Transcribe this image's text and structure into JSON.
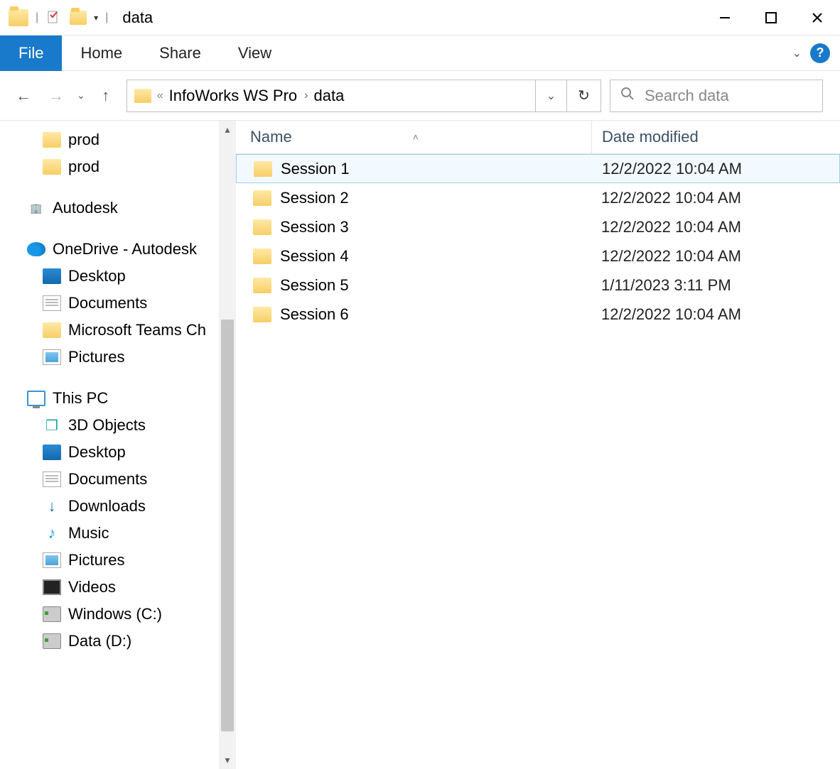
{
  "window": {
    "title": "data"
  },
  "ribbon": {
    "file": "File",
    "home": "Home",
    "share": "Share",
    "view": "View"
  },
  "address": {
    "overflow": "«",
    "segments": [
      "InfoWorks WS Pro",
      "data"
    ]
  },
  "search": {
    "placeholder": "Search data"
  },
  "columns": {
    "name": "Name",
    "date": "Date modified"
  },
  "files": [
    {
      "name": "Session 1",
      "date": "12/2/2022 10:04 AM",
      "selected": true
    },
    {
      "name": "Session 2",
      "date": "12/2/2022 10:04 AM",
      "selected": false
    },
    {
      "name": "Session 3",
      "date": "12/2/2022 10:04 AM",
      "selected": false
    },
    {
      "name": "Session 4",
      "date": "12/2/2022 10:04 AM",
      "selected": false
    },
    {
      "name": "Session 5",
      "date": "1/11/2023 3:11 PM",
      "selected": false
    },
    {
      "name": "Session 6",
      "date": "12/2/2022 10:04 AM",
      "selected": false
    }
  ],
  "sidebar": {
    "items": [
      {
        "kind": "item",
        "label": "prod",
        "icon": "folder",
        "indent": 1
      },
      {
        "kind": "item",
        "label": "prod",
        "icon": "folder",
        "indent": 1
      },
      {
        "kind": "gap"
      },
      {
        "kind": "item",
        "label": "Autodesk",
        "icon": "autodesk",
        "indent": 0
      },
      {
        "kind": "gap"
      },
      {
        "kind": "item",
        "label": "OneDrive - Autodesk",
        "icon": "onedrive",
        "indent": 0
      },
      {
        "kind": "item",
        "label": "Desktop",
        "icon": "desktop",
        "indent": 1
      },
      {
        "kind": "item",
        "label": "Documents",
        "icon": "doc",
        "indent": 1
      },
      {
        "kind": "item",
        "label": "Microsoft Teams Ch",
        "icon": "folder",
        "indent": 1
      },
      {
        "kind": "item",
        "label": "Pictures",
        "icon": "pic",
        "indent": 1
      },
      {
        "kind": "gap"
      },
      {
        "kind": "item",
        "label": "This PC",
        "icon": "monitor",
        "indent": 0
      },
      {
        "kind": "item",
        "label": "3D Objects",
        "icon": "cube",
        "indent": 1
      },
      {
        "kind": "item",
        "label": "Desktop",
        "icon": "desktop",
        "indent": 1
      },
      {
        "kind": "item",
        "label": "Documents",
        "icon": "doc",
        "indent": 1
      },
      {
        "kind": "item",
        "label": "Downloads",
        "icon": "download",
        "indent": 1
      },
      {
        "kind": "item",
        "label": "Music",
        "icon": "music",
        "indent": 1
      },
      {
        "kind": "item",
        "label": "Pictures",
        "icon": "pic",
        "indent": 1
      },
      {
        "kind": "item",
        "label": "Videos",
        "icon": "video",
        "indent": 1
      },
      {
        "kind": "item",
        "label": "Windows (C:)",
        "icon": "drive",
        "indent": 1
      },
      {
        "kind": "item",
        "label": "Data (D:)",
        "icon": "drive",
        "indent": 1
      }
    ]
  }
}
